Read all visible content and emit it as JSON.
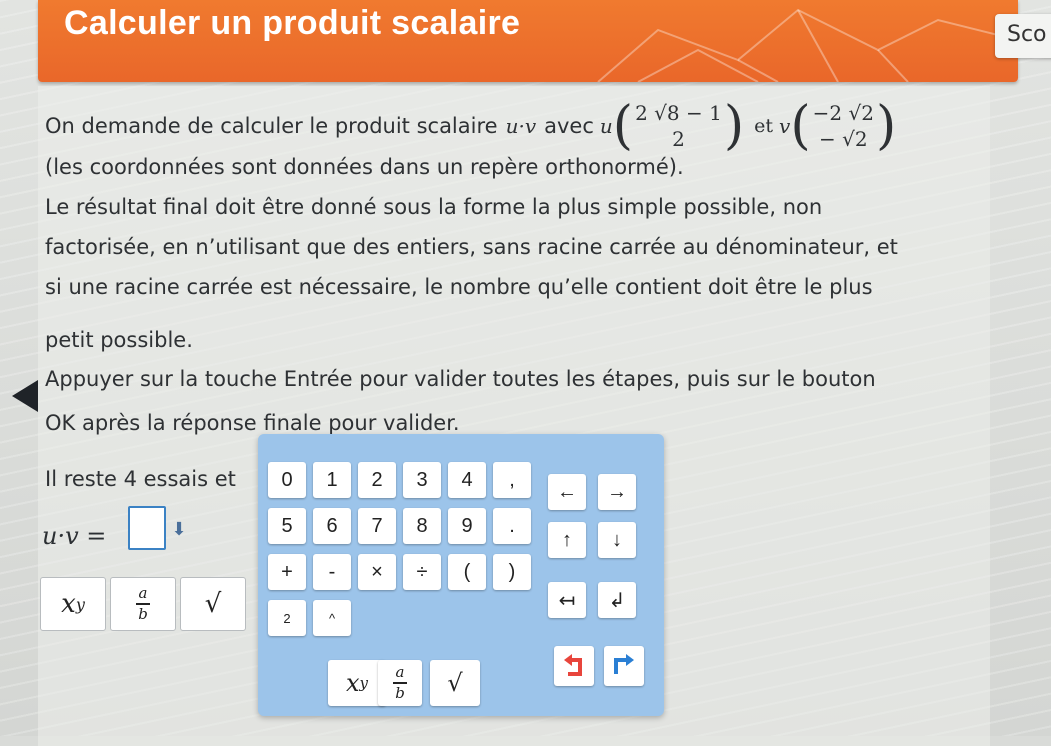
{
  "header": {
    "title": "Calculer un produit scalaire",
    "score_label": "Sco"
  },
  "statement": {
    "line1_text": "On demande de calculer le produit scalaire",
    "uv": "u·v",
    "avec": "avec",
    "u_name": "u",
    "u_coords": [
      "2 √8 − 1",
      "2"
    ],
    "et": "et",
    "v_name": "v",
    "v_coords": [
      "−2 √2",
      "− √2"
    ],
    "line2": "(les coordonnées sont données dans un repère orthonormé).",
    "line3": "Le résultat final doit être donné sous la forme la plus simple possible, non",
    "line4": "factorisée, en n’utilisant que des entiers, sans racine carrée au dénominateur, et",
    "line5": "si une racine carrée est nécessaire, le nombre qu’elle contient doit être le plus",
    "line6": "petit possible.",
    "line7": "Appuyer sur la touche Entrée pour valider toutes les étapes, puis sur le bouton",
    "line8": "OK après la réponse finale pour valider.",
    "attempts": "Il reste 4 essais et"
  },
  "answer": {
    "lhs": "u·v =",
    "down_icon": "arrow-down-icon"
  },
  "tools": {
    "power": "x^y",
    "power_base": "x",
    "power_exp": "y",
    "fraction_num": "a",
    "fraction_den": "b",
    "sqrt": "√"
  },
  "keypad": {
    "row1": [
      "0",
      "1",
      "2",
      "3",
      "4",
      ","
    ],
    "row2": [
      "5",
      "6",
      "7",
      "8",
      "9",
      "."
    ],
    "row3": [
      "+",
      "-",
      "×",
      "÷",
      "(",
      ")"
    ],
    "row4": [
      "2",
      "^"
    ],
    "nav_left": "←",
    "nav_right": "→",
    "nav_up": "↑",
    "nav_down": "↓",
    "backspace": "↤",
    "enter": "↲",
    "power_base": "x",
    "power_exp": "y",
    "frac_num": "a",
    "frac_den": "b",
    "sqrt": "√",
    "undo_icon": "undo-icon",
    "redo_icon": "redo-icon",
    "undo_color": "#e8453c",
    "redo_color": "#2a7fd4"
  },
  "colors": {
    "banner": "#e9672a",
    "keypad": "#9cc4ea",
    "answer_border": "#3b82c4"
  }
}
